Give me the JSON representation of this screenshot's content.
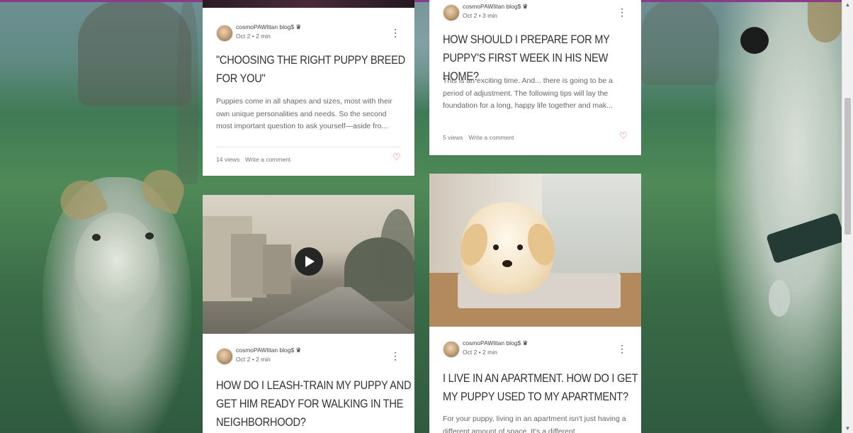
{
  "cards": [
    {
      "author": "cosmoPAWlitan blog$",
      "date": "Oct 2",
      "read_time": "2 min",
      "title": "\"CHOOSING THE RIGHT PUPPY BREED FOR YOU\"",
      "excerpt": "Puppies come in all shapes and sizes, most with their own unique personalities and needs. So the second most important question to ask yourself—aside fro...",
      "views": "14 views",
      "comment": "Write a comment"
    },
    {
      "author": "cosmoPAWlitan blog$",
      "date": "Oct 2",
      "read_time": "3 min",
      "title": "HOW SHOULD I PREPARE FOR MY PUPPY'S FIRST WEEK IN HIS NEW HOME?",
      "excerpt": "This is an exciting time. And... there is going to be a period of adjustment. The following tips will lay the foundation for a long, happy life together and mak...",
      "views": "5 views",
      "comment": "Write a comment"
    },
    {
      "author": "cosmoPAWlitan blog$",
      "date": "Oct 2",
      "read_time": "2 min",
      "title": "HOW DO I LEASH-TRAIN MY PUPPY AND GET HIM READY FOR WALKING IN THE NEIGHBORHOOD?"
    },
    {
      "author": "cosmoPAWlitan blog$",
      "date": "Oct 2",
      "read_time": "2 min",
      "title": "I LIVE IN AN APARTMENT. HOW DO I GET MY PUPPY USED TO MY APARTMENT?",
      "excerpt": "For your puppy, living in an apartment isn't just having a different amount of space. It's a different"
    }
  ],
  "separator": "•",
  "icons": {
    "crown": "crown-icon",
    "more": "more-options-icon",
    "heart": "heart-icon",
    "play": "play-icon"
  },
  "colors": {
    "accent_heart": "#e0483e",
    "top_bar": "#8c3b8a"
  }
}
